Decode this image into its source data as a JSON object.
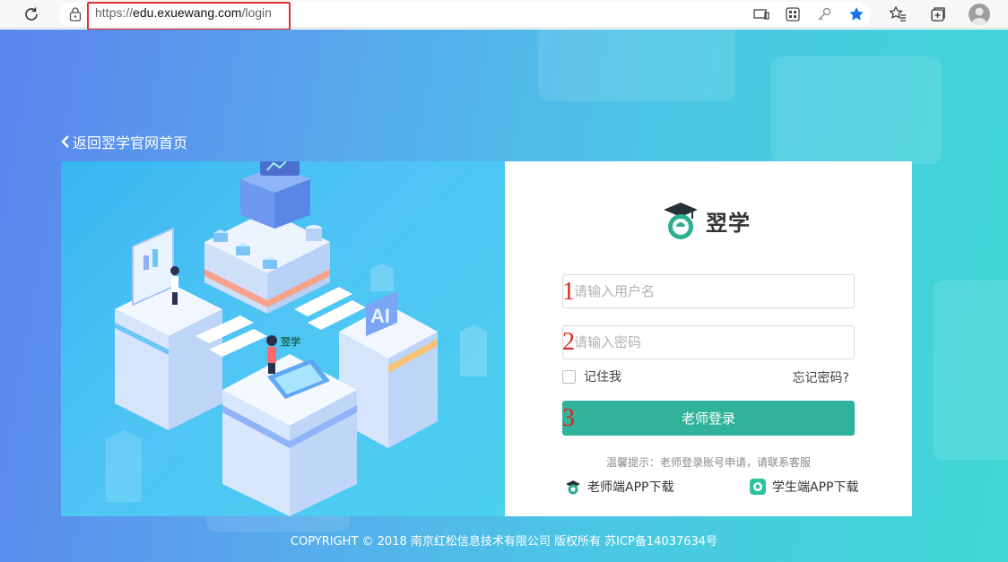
{
  "browser": {
    "url_scheme": "https://",
    "url_host": "edu.exuewang.com",
    "url_path": "/login"
  },
  "page": {
    "back_link": "返回翌学官网首页",
    "logo_text": "翌学",
    "username_placeholder": "请输入用户名",
    "password_placeholder": "请输入密码",
    "remember_label": "记住我",
    "forgot_label": "忘记密码?",
    "login_button": "老师登录",
    "tip": "温馨提示：老师登录账号申请，请联系客服",
    "teacher_app": "老师端APP下载",
    "student_app": "学生端APP下载",
    "copyright": "COPYRIGHT © 2018 南京红松信息技术有限公司 版权所有 苏ICP备14037634号",
    "illustration_text": "翌学",
    "illustration_ai": "AI"
  },
  "annotations": {
    "n1": "1",
    "n2": "2",
    "n3": "3"
  },
  "colors": {
    "accent": "#30b39a",
    "annotation": "#d8261f",
    "url_highlight": "#e0302b"
  }
}
